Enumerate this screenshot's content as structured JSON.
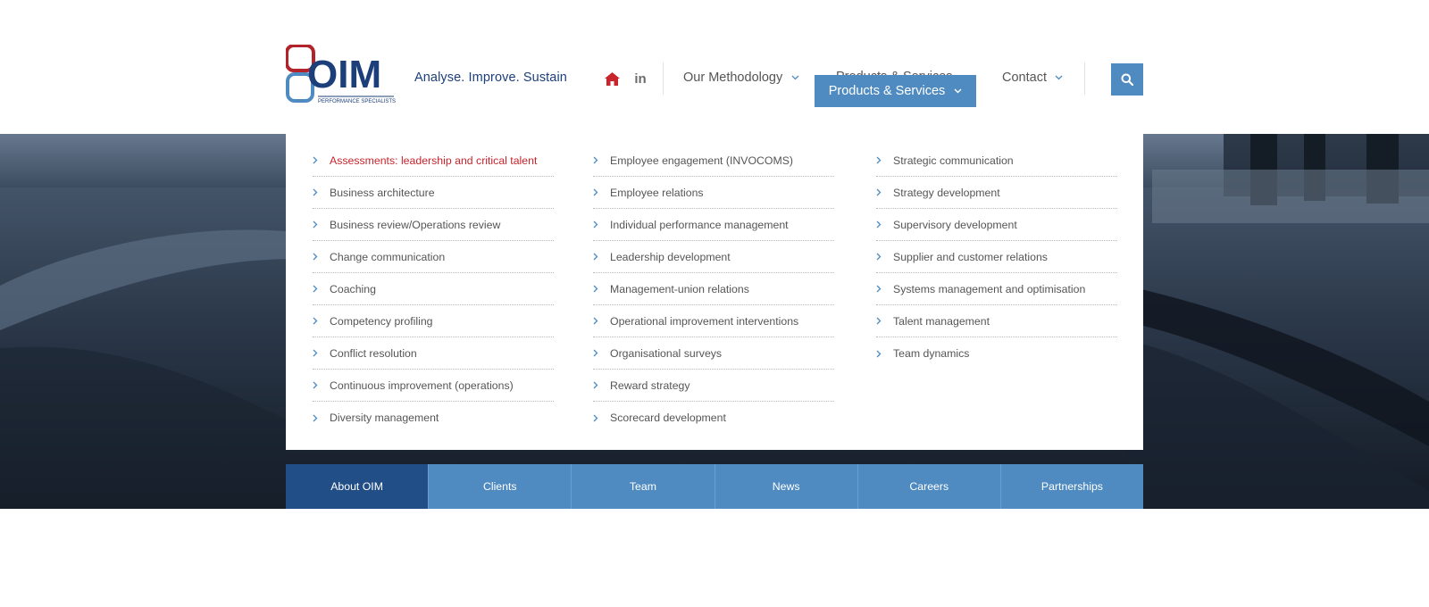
{
  "brand": {
    "logo_text": "OIM",
    "logo_subtext": "PERFORMANCE SPECIALISTS",
    "tagline": "Analyse. Improve. Sustain",
    "colors": {
      "navy": "#1c3f7a",
      "red": "#b3232b",
      "blue": "#4f8bc1",
      "dark_blue": "#214e86"
    }
  },
  "header": {
    "icons": [
      "home-icon",
      "linkedin-icon",
      "search-icon"
    ],
    "nav": {
      "methodology": "Our Methodology",
      "products_ghost": "Products & Services",
      "products": "Products & Services",
      "contact": "Contact"
    }
  },
  "mega_menu": {
    "columns": [
      [
        "Assessments: leadership and critical talent",
        "Business architecture",
        "Business review/Operations review",
        "Change communication",
        "Coaching",
        "Competency profiling",
        "Conflict resolution",
        "Continuous improvement (operations)",
        "Diversity management"
      ],
      [
        "Employee engagement (INVOCOMS)",
        "Employee relations",
        "Individual performance management",
        "Leadership development",
        "Management-union relations",
        "Operational improvement interventions",
        "Organisational surveys",
        "Reward strategy",
        "Scorecard development"
      ],
      [
        "Strategic communication",
        "Strategy development",
        "Supervisory development",
        "Supplier and customer relations",
        "Systems management and optimisation",
        "Talent management",
        "Team dynamics"
      ]
    ],
    "active_item": "Assessments: leadership and critical talent",
    "active_color": "#c8242b"
  },
  "subnav": {
    "items": [
      "About OIM",
      "Clients",
      "Team",
      "News",
      "Careers",
      "Partnerships"
    ],
    "active": "About OIM"
  }
}
